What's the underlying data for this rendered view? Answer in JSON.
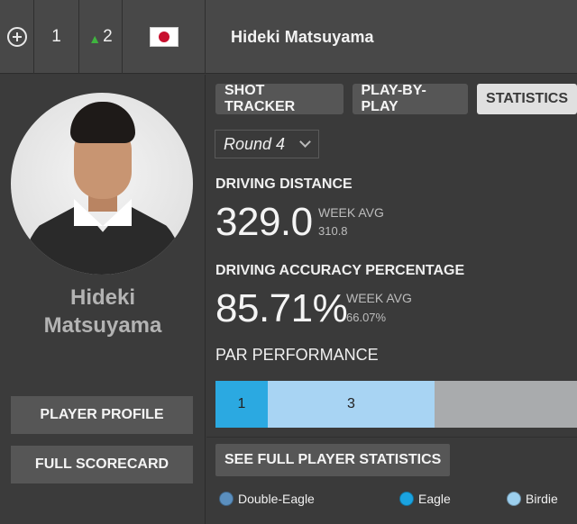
{
  "topbar": {
    "position": "1",
    "movement": "2",
    "country": "Japan",
    "player_name": "Hideki Matsuyama"
  },
  "sidebar": {
    "player_name": "Hideki Matsuyama",
    "buttons": [
      "PLAYER PROFILE",
      "FULL SCORECARD"
    ]
  },
  "tabs": [
    {
      "label": "SHOT TRACKER",
      "active": false
    },
    {
      "label": "PLAY-BY-PLAY",
      "active": false
    },
    {
      "label": "STATISTICS",
      "active": true
    }
  ],
  "round_select": {
    "value": "Round 4"
  },
  "stats": [
    {
      "title": "DRIVING DISTANCE",
      "value": "329.0",
      "avg_label": "WEEK AVG",
      "avg_value": "310.8"
    },
    {
      "title": "DRIVING ACCURACY PERCENTAGE",
      "value": "85.71%",
      "avg_label": "WEEK AVG",
      "avg_value": "66.07%"
    }
  ],
  "par_performance": {
    "title": "PAR PERFORMANCE",
    "segments": [
      {
        "value": "1",
        "fraction": 0.1437,
        "color": "#2ba9e1"
      },
      {
        "value": "3",
        "fraction": 0.4613,
        "color": "#a8d4f3"
      }
    ],
    "remainder_color": "#a9abad"
  },
  "see_stats_button": "SEE FULL PLAYER STATISTICS",
  "legend": [
    {
      "label": "Double-Eagle",
      "color": "#5b8fbe"
    },
    {
      "label": "Eagle",
      "color": "#1aa3e0"
    },
    {
      "label": "Birdie",
      "color": "#9ccfee"
    }
  ],
  "colors": {
    "accent_green": "#3fb43f",
    "active_tab_bg": "#e0e0e0"
  }
}
